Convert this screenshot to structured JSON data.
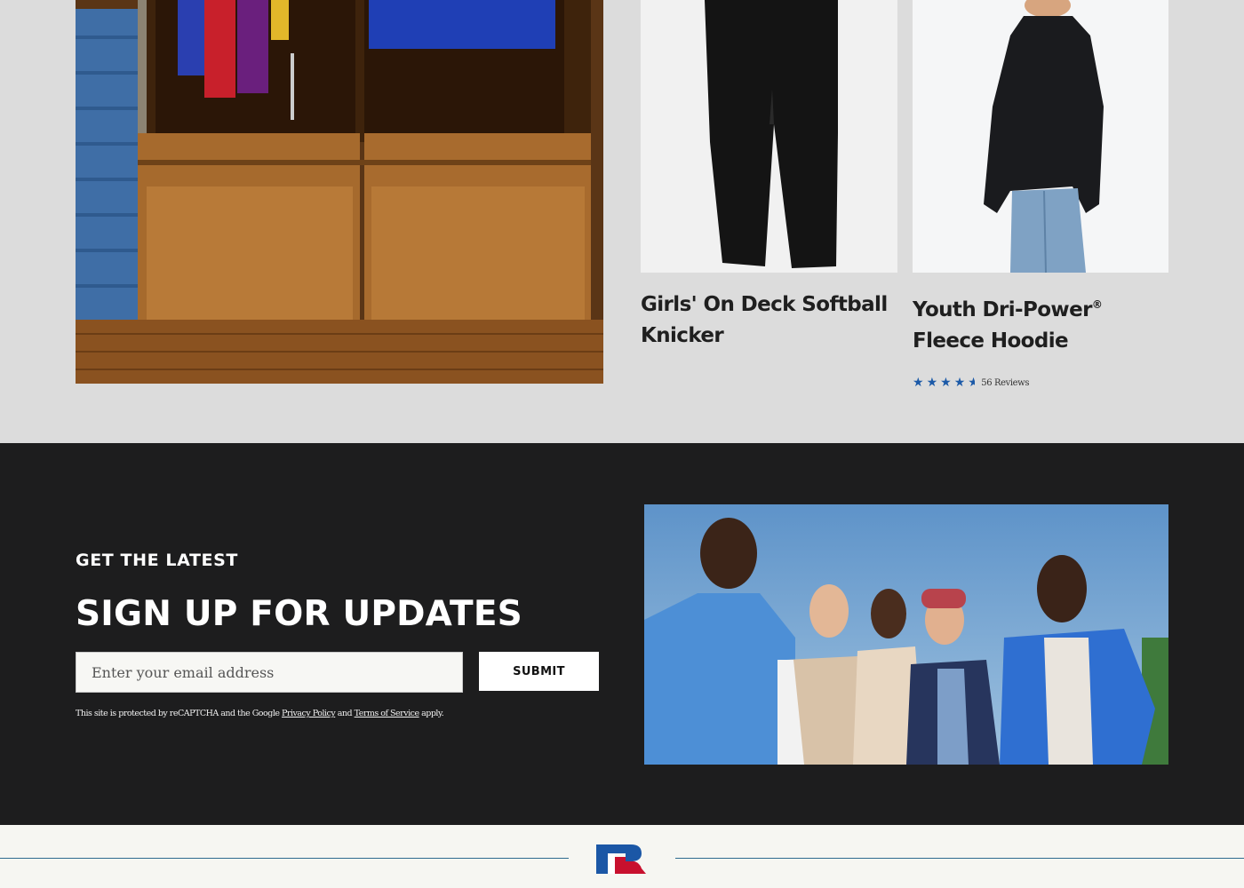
{
  "products": [
    {
      "title": "Girls' On Deck Softball Knicker",
      "title_sup": "",
      "title_suffix": "",
      "image_icon": "black-softball-pants-image"
    },
    {
      "title": "Youth Dri-Power",
      "title_sup": "®",
      "title_suffix": " Fleece Hoodie",
      "image_icon": "black-hoodie-image",
      "rating": 4.5,
      "rating_max": 5,
      "reviews_label": "56 Reviews"
    }
  ],
  "feature_image": {
    "icon": "locker-room-image"
  },
  "signup": {
    "eyebrow": "GET THE LATEST",
    "headline": "SIGN UP FOR UPDATES",
    "email_placeholder": "Enter your email address",
    "email_value": "",
    "submit_label": "SUBMIT",
    "legal_prefix": "This site is protected by reCAPTCHA and the Google ",
    "privacy_link": "Privacy Policy",
    "legal_and": " and ",
    "terms_link": "Terms of Service",
    "legal_suffix": " apply.",
    "image_icon": "group-photo-image"
  },
  "footer": {
    "logo_icon": "russell-r-logo"
  },
  "colors": {
    "section_bg": "#dcdcdc",
    "signup_bg": "#1d1d1e",
    "footer_bg": "#f6f6f2",
    "star": "#1c5aa8",
    "logo_blue": "#1b57a6",
    "logo_red": "#c8102e",
    "rule": "#2e6b8f"
  }
}
